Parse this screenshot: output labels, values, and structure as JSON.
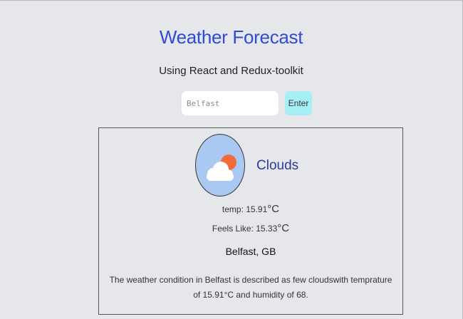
{
  "header": {
    "title": "Weather Forecast",
    "subtitle": "Using React and Redux-toolkit"
  },
  "search": {
    "placeholder": "Belfast",
    "button_label": "Enter"
  },
  "weather": {
    "icon": "partly-cloudy-icon",
    "condition": "Clouds",
    "temp_label": "temp: 15.91",
    "temp_unit": "°C",
    "feels_label": "Feels Like: 15.33",
    "feels_unit": "°C",
    "location": "Belfast, GB",
    "description": "The weather condition in Belfast is described as few cloudswith temprature of 15.91°C and humidity of 68."
  },
  "colors": {
    "background": "#e6e7eb",
    "title": "#2e4bd6",
    "button": "#a6f0f5",
    "icon_circle": "#a9c9f2",
    "sun": "#f26b3a",
    "condition_text": "#2b3a9c"
  }
}
